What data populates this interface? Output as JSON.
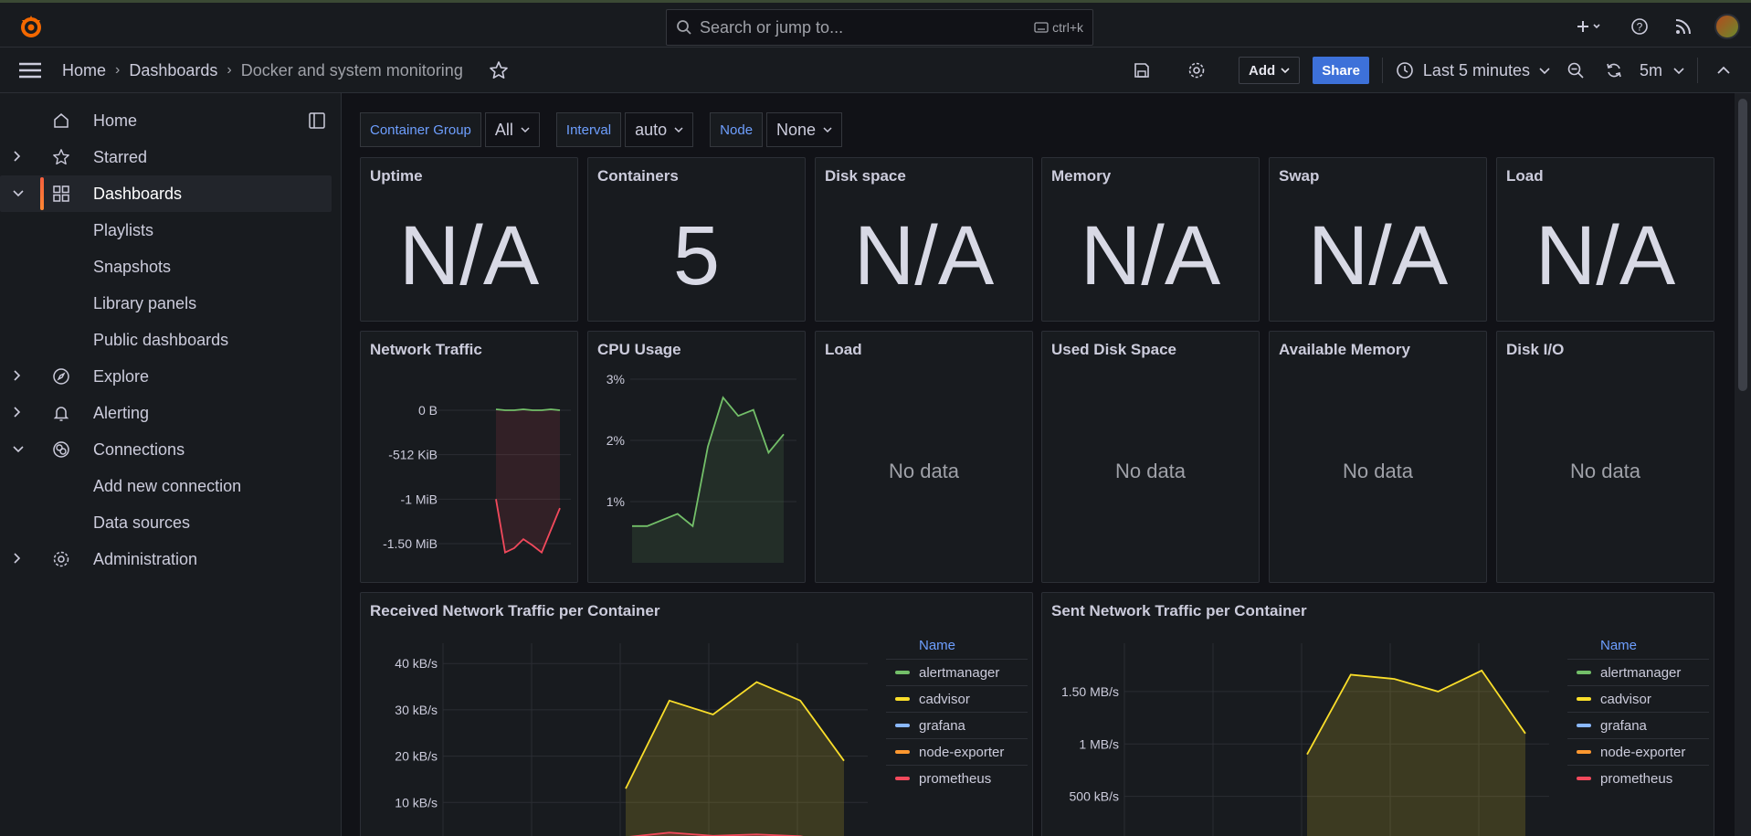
{
  "search": {
    "placeholder": "Search or jump to...",
    "shortcut": "ctrl+k"
  },
  "breadcrumb": {
    "home": "Home",
    "dashboards": "Dashboards",
    "current": "Docker and system monitoring"
  },
  "toolbar": {
    "add_label": "Add",
    "share_label": "Share",
    "time_range": "Last 5 minutes",
    "refresh_interval": "5m"
  },
  "sidebar": {
    "items": [
      {
        "label": "Home",
        "icon": "home-icon"
      },
      {
        "label": "Starred",
        "icon": "star-icon"
      },
      {
        "label": "Dashboards",
        "icon": "dashboards-icon"
      },
      {
        "label": "Playlists"
      },
      {
        "label": "Snapshots"
      },
      {
        "label": "Library panels"
      },
      {
        "label": "Public dashboards"
      },
      {
        "label": "Explore",
        "icon": "compass-icon"
      },
      {
        "label": "Alerting",
        "icon": "bell-icon"
      },
      {
        "label": "Connections",
        "icon": "connections-icon"
      },
      {
        "label": "Add new connection"
      },
      {
        "label": "Data sources"
      },
      {
        "label": "Administration",
        "icon": "gear-icon"
      }
    ]
  },
  "variables": [
    {
      "label": "Container Group",
      "value": "All"
    },
    {
      "label": "Interval",
      "value": "auto"
    },
    {
      "label": "Node",
      "value": "None"
    }
  ],
  "stats": [
    {
      "title": "Uptime",
      "value": "N/A"
    },
    {
      "title": "Containers",
      "value": "5"
    },
    {
      "title": "Disk space",
      "value": "N/A"
    },
    {
      "title": "Memory",
      "value": "N/A"
    },
    {
      "title": "Swap",
      "value": "N/A"
    },
    {
      "title": "Load",
      "value": "N/A"
    }
  ],
  "row2": [
    {
      "title": "Network Traffic"
    },
    {
      "title": "CPU Usage"
    },
    {
      "title": "Load",
      "nodata": "No data"
    },
    {
      "title": "Used Disk Space",
      "nodata": "No data"
    },
    {
      "title": "Available Memory",
      "nodata": "No data"
    },
    {
      "title": "Disk I/O",
      "nodata": "No data"
    }
  ],
  "colors": {
    "accent": "#3d71d9",
    "green": "#73bf69",
    "yellow": "#fade2a",
    "blue": "#8ab8ff",
    "orange": "#ff9830",
    "red": "#f2495c"
  },
  "chart_data": [
    {
      "type": "area",
      "title": "Network Traffic",
      "yticks": [
        "0 B",
        "-512 KiB",
        "-1 MiB",
        "-1.50 MiB"
      ],
      "series": [
        {
          "values": [
            0.01,
            0.0,
            0.0,
            0.01,
            0.0,
            0.0,
            0.01,
            0.0
          ]
        },
        {
          "values": [
            -1.0,
            -1.6,
            -1.55,
            -1.45,
            -1.52,
            -1.6,
            -1.35,
            -1.1
          ]
        }
      ]
    },
    {
      "type": "area",
      "title": "CPU Usage",
      "yticks": [
        "3%",
        "2%",
        "1%"
      ],
      "series": [
        {
          "values": [
            0.6,
            0.6,
            0.7,
            0.8,
            0.6,
            1.9,
            2.7,
            2.4,
            2.5,
            1.8,
            2.1
          ]
        }
      ]
    },
    {
      "type": "area",
      "title": "Received Network Traffic per Container",
      "yticks": [
        "40 kB/s",
        "30 kB/s",
        "20 kB/s",
        "10 kB/s"
      ],
      "ylim": [
        0,
        43
      ],
      "legend_title": "Name",
      "series": [
        {
          "name": "alertmanager",
          "color": "#73bf69",
          "values": []
        },
        {
          "name": "cadvisor",
          "color": "#fade2a",
          "values": [
            13,
            32,
            29,
            36,
            32,
            19
          ]
        },
        {
          "name": "grafana",
          "color": "#8ab8ff",
          "values": []
        },
        {
          "name": "node-exporter",
          "color": "#ff9830",
          "values": []
        },
        {
          "name": "prometheus",
          "color": "#f2495c",
          "values": [
            2.5,
            3.5,
            2.8,
            3.1,
            2.7,
            1.0
          ]
        }
      ]
    },
    {
      "type": "area",
      "title": "Sent Network Traffic per Container",
      "yticks": [
        "1.50 MB/s",
        "1 MB/s",
        "500 kB/s"
      ],
      "ylim": [
        0,
        1.9
      ],
      "legend_title": "Name",
      "series": [
        {
          "name": "alertmanager",
          "color": "#73bf69",
          "values": []
        },
        {
          "name": "cadvisor",
          "color": "#fade2a",
          "values": [
            0.9,
            1.66,
            1.62,
            1.5,
            1.7,
            1.1
          ]
        },
        {
          "name": "grafana",
          "color": "#8ab8ff",
          "values": []
        },
        {
          "name": "node-exporter",
          "color": "#ff9830",
          "values": []
        },
        {
          "name": "prometheus",
          "color": "#f2495c",
          "values": []
        }
      ]
    }
  ]
}
